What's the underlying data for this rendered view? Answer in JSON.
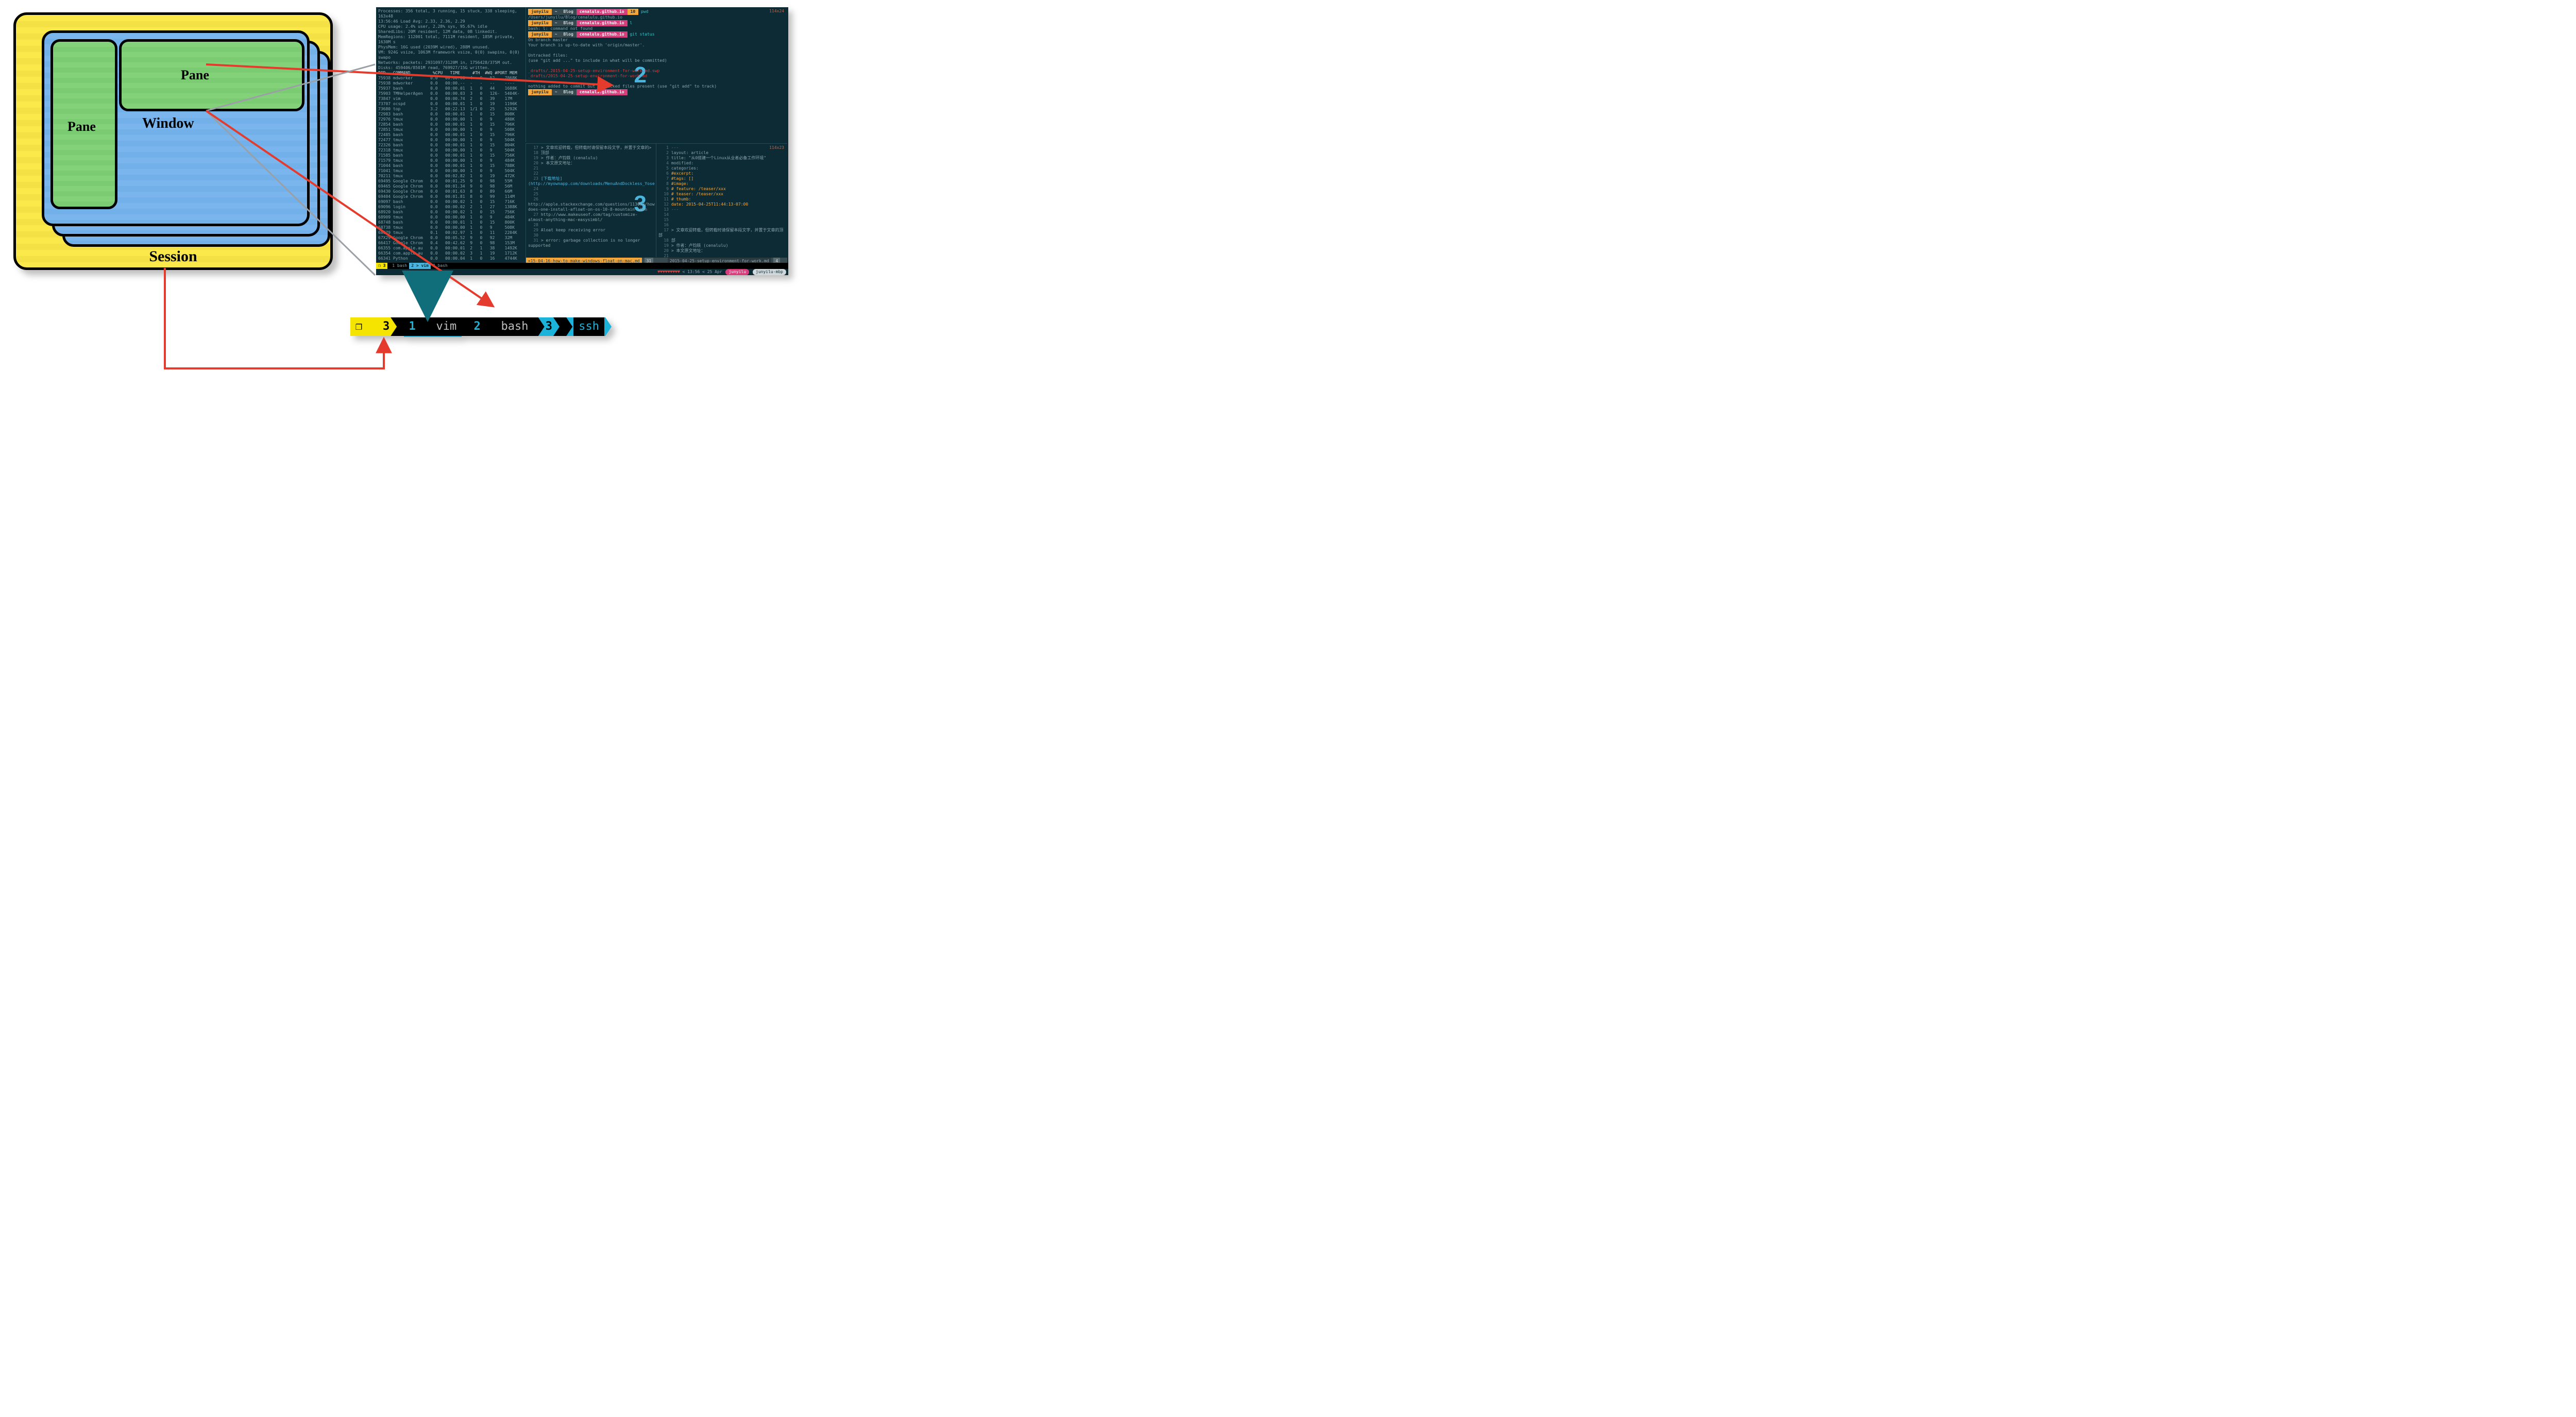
{
  "diagram": {
    "session_label": "Session",
    "window_label": "Window",
    "pane_labels": [
      "Pane",
      "Pane"
    ]
  },
  "terminal": {
    "pane_sizes": {
      "top_right": "114x24",
      "bottom_right": "114x23"
    },
    "top_left": {
      "header_lines": [
        "Processes: 356 total, 3 running, 15 stuck, 338 sleeping, 163x48",
        "13:56:46 Load Avg: 2.33, 2.36, 2.29",
        "CPU usage: 2.4% user, 2.28% sys, 95.67% idle",
        "SharedLibs: 20M resident, 12M data, 0B linkedit.",
        "MemRegions: 112001 total, 7111M resident, 185M private, 1630M s",
        "PhysMem: 16G used (2039M wired), 288M unused.",
        "VM: 924G vsize, 1063M framework vsize, 0(0) swapins, 0(0) swapo",
        "Networks: packets: 2931097/3120M in, 1756428/375M out.",
        "Disks: 459406/8501M read, 769927/15G written."
      ],
      "columns": "PID   COMMAND         %CPU   TIME     #TH  #WQ #PORT MEM",
      "rows": [
        [
          "75938",
          "mdworker",
          "0.0",
          "00:00.06",
          "4",
          "0",
          "52",
          "7868K"
        ],
        [
          "75938",
          "mdworker",
          "0.0",
          "00:00.--",
          "-",
          "-",
          "--",
          "----"
        ],
        [
          "75937",
          "bash",
          "0.0",
          "00:00.01",
          "1",
          "0",
          "44",
          "1688K"
        ],
        [
          "75903",
          "TMHelperAgen",
          "0.0",
          "00:00.03",
          "3",
          "0",
          "126-",
          "5404K-"
        ],
        [
          "73847",
          "vim",
          "0.0",
          "00:00.74",
          "2",
          "0",
          "39",
          "17M"
        ],
        [
          "73707",
          "ocspd",
          "0.0",
          "00:00.01",
          "1",
          "0",
          "19",
          "1196K"
        ],
        [
          "73680",
          "top",
          "3.2",
          "00:22.13",
          "1/1",
          "0",
          "25",
          "5292K"
        ],
        [
          "72983",
          "bash",
          "0.0",
          "00:00.01",
          "1",
          "0",
          "15",
          "808K"
        ],
        [
          "72976",
          "tmux",
          "0.0",
          "00:00.00",
          "1",
          "0",
          "9",
          "480K"
        ],
        [
          "72854",
          "bash",
          "0.0",
          "00:00.01",
          "1",
          "0",
          "15",
          "796K"
        ],
        [
          "72851",
          "tmux",
          "0.0",
          "00:00.00",
          "1",
          "0",
          "9",
          "508K"
        ],
        [
          "72485",
          "bash",
          "0.0",
          "00:00.01",
          "1",
          "0",
          "15",
          "796K"
        ],
        [
          "72477",
          "tmux",
          "0.0",
          "00:00.00",
          "1",
          "0",
          "9",
          "504K"
        ],
        [
          "72326",
          "bash",
          "0.0",
          "00:00.01",
          "1",
          "0",
          "15",
          "804K"
        ],
        [
          "72318",
          "tmux",
          "0.0",
          "00:00.00",
          "1",
          "0",
          "9",
          "504K"
        ],
        [
          "71585",
          "bash",
          "0.0",
          "00:00.01",
          "1",
          "0",
          "15",
          "756K"
        ],
        [
          "71579",
          "tmux",
          "0.0",
          "00:00.00",
          "1",
          "0",
          "9",
          "484K"
        ],
        [
          "71044",
          "bash",
          "0.0",
          "00:00.01",
          "1",
          "0",
          "15",
          "788K"
        ],
        [
          "71041",
          "tmux",
          "0.0",
          "00:00.00",
          "1",
          "0",
          "9",
          "504K"
        ],
        [
          "70211",
          "tmux",
          "0.0",
          "00:02.82",
          "1",
          "0",
          "19",
          "472K"
        ],
        [
          "69495",
          "Google Chrom",
          "0.0",
          "00:01.25",
          "9",
          "0",
          "98",
          "55M"
        ],
        [
          "69465",
          "Google Chrom",
          "0.0",
          "00:01.34",
          "9",
          "0",
          "98",
          "56M"
        ],
        [
          "69430",
          "Google Chrom",
          "0.0",
          "00:01.63",
          "8",
          "0",
          "89",
          "66M"
        ],
        [
          "69404",
          "Google Chrom",
          "0.0",
          "00:01.81",
          "8",
          "0",
          "99",
          "114M"
        ],
        [
          "69097",
          "bash",
          "0.0",
          "00:00.02",
          "1",
          "0",
          "15",
          "716K"
        ],
        [
          "69096",
          "login",
          "0.0",
          "00:00.02",
          "2",
          "1",
          "27",
          "1388K"
        ],
        [
          "68920",
          "bash",
          "0.0",
          "00:00.02",
          "1",
          "0",
          "15",
          "756K"
        ],
        [
          "68909",
          "tmux",
          "0.0",
          "00:00.00",
          "1",
          "0",
          "9",
          "484K"
        ],
        [
          "68748",
          "bash",
          "0.0",
          "00:00.01",
          "1",
          "0",
          "15",
          "800K"
        ],
        [
          "68738",
          "tmux",
          "0.0",
          "00:00.00",
          "1",
          "0",
          "9",
          "508K"
        ],
        [
          "68679",
          "tmux",
          "0.1",
          "00:02.97",
          "1",
          "0",
          "11",
          "2204K"
        ],
        [
          "67X29",
          "Google Chrom",
          "0.0",
          "00:05.52",
          "9",
          "0",
          "92",
          "32M"
        ],
        [
          "66417",
          "Google Chrom",
          "0.4",
          "00:42.62",
          "9",
          "0",
          "98",
          "153M"
        ],
        [
          "66355",
          "com.apple.au",
          "0.0",
          "00:00.01",
          "2",
          "1",
          "38",
          "1492K"
        ],
        [
          "66354",
          "com.apple.au",
          "0.0",
          "00:00.02",
          "3",
          "1",
          "19",
          "1712K"
        ],
        [
          "66341",
          "Python",
          "0.0",
          "00:00.04",
          "1",
          "0",
          "16",
          "4744K"
        ]
      ]
    },
    "top_right": {
      "prompt_segments": {
        "user": "junyilu",
        "sep": "~",
        "folder": "Blog",
        "repo": "cenalulu.github.io"
      },
      "lines": [
        {
          "type": "prompt",
          "badge": "10",
          "cmd": "pwd"
        },
        {
          "type": "out",
          "text": "/Users/junyilu/Blog/cenalulu.github.io"
        },
        {
          "type": "prompt",
          "cmd": "l"
        },
        {
          "type": "out",
          "text": "bash: l: command not found"
        },
        {
          "type": "prompt",
          "cmd": "git status"
        },
        {
          "type": "out",
          "text": "On branch master"
        },
        {
          "type": "out",
          "text": "Your branch is up-to-date with 'origin/master'."
        },
        {
          "type": "blank"
        },
        {
          "type": "out",
          "text": "Untracked files:"
        },
        {
          "type": "out",
          "text": "  (use \"git add <file>...\" to include in what will be committed)"
        },
        {
          "type": "blank"
        },
        {
          "type": "red",
          "text": "        _drafts/.2015-04-25-setup-environment-for-work.md.swp"
        },
        {
          "type": "red",
          "text": "        _drafts/2015-04-25-setup-environment-for-work.md"
        },
        {
          "type": "blank"
        },
        {
          "type": "out",
          "text": "nothing added to commit but untracked files present (use \"git add\" to track)"
        },
        {
          "type": "prompt",
          "cmd": ""
        }
      ]
    },
    "bottom_right": {
      "left_pane": {
        "line_numbers": [
          17,
          18,
          19,
          20,
          21,
          22,
          23,
          24,
          25,
          26,
          27,
          28,
          29,
          30,
          31
        ],
        "lines": [
          "> 文章欢迎转载，但转载时请保留本段文字，并置于文章的>",
          "  顶部",
          "> 作者：卢钧轶 (cenalulu)",
          "> 本文原文地址：<http://cenalulu.github.io{{ page.url }}>",
          "",
          "",
          "[下载地址](http://myownapp.com/downloads/MenuAndDockless_Yosemite_Alpha.zip)",
          "",
          "",
          "http://apple.stackexchange.com/questions/113093/how-does-one-install-afloat-on-os-10-8-mountain-lion",
          "http://www.makeuseof.com/tag/customize-almost-anything-mac-easysimbl/",
          "",
          "Aloat keep receiving error",
          "",
          "> error: garbage collection is no longer supported"
        ],
        "status": {
          "name": "<15-04-16-how-to-make-windows-float-on-mac.md",
          "col": "31"
        }
      },
      "right_pane": {
        "line_numbers": [
          1,
          2,
          3,
          4,
          5,
          6,
          7,
          8,
          9,
          10,
          11,
          12,
          13,
          14,
          15,
          16,
          17,
          18,
          19,
          20,
          21
        ],
        "lines": [
          "---",
          "layout: article",
          "title: \"从0搭建一个Linux从业者必备工作环境\"",
          "modified:",
          "categories:",
          "#excerpt:",
          "#tags: []",
          "#image:",
          "#   feature: /teaser/xxx",
          "#   teaser: /teaser/xxx",
          "#   thumb:",
          "date: 2015-04-25T11:44:13-07:00",
          "---",
          "",
          "",
          "",
          "> 文章欢迎转载，但转载时请保留本段文字，并置于文章的顶部",
          "  部",
          "> 作者：卢钧轶 (cenalulu)",
          "> 本文原文地址：<http://cenalulu.github.io{{ page.url }}>",
          ""
        ],
        "status": {
          "name": "2015-04-25-setup-environment-for-work.md",
          "col": "4"
        }
      }
    },
    "mini_status": {
      "session": "❐ 3",
      "tabs": [
        {
          "index": "1",
          "name": "bash",
          "active": false
        },
        {
          "index": "2",
          "name": "vim",
          "active": true
        },
        {
          "index": "3",
          "name": "bash",
          "active": false
        }
      ]
    },
    "bottom_bar": {
      "hearts": "♥♥♥♥♥♥♥♥♥",
      "time": "13:56",
      "date": "25 Apr",
      "user": "junyilu",
      "host": "junyilu-mbp"
    },
    "big_digits": {
      "top_right": "2",
      "bottom_right": "3"
    }
  },
  "status_zoom": {
    "session": {
      "icon": "❐",
      "number": "3"
    },
    "windows": [
      {
        "index": "1",
        "name": "vim",
        "active": false
      },
      {
        "index": "2",
        "name": "bash",
        "active": false
      },
      {
        "index": "3",
        "name": "ssh",
        "active": true
      }
    ]
  }
}
